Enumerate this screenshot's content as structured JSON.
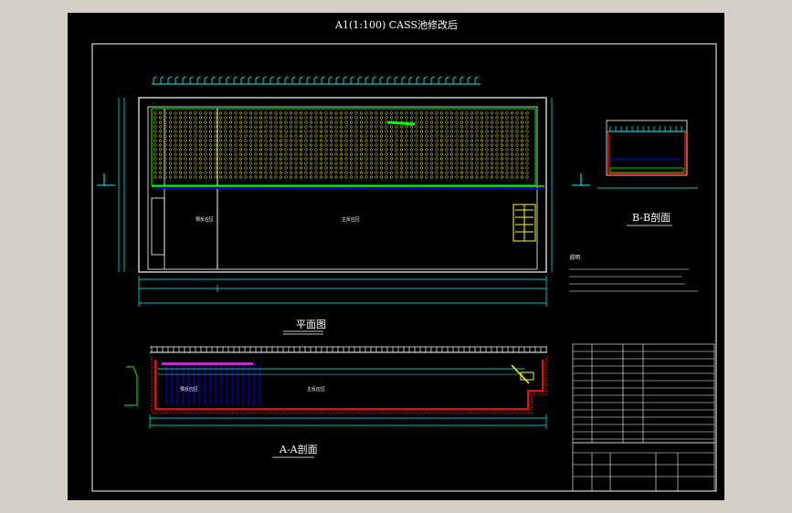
{
  "drawing": {
    "title": "A1(1:100) CASS池修改后",
    "plan_label": "平面图",
    "section_aa_label": "A-A剖面",
    "section_bb_label": "B-B剖面",
    "notes_heading": "说明"
  },
  "colors": {
    "background": "#000000",
    "frame": "#ffffff",
    "tank": "#00ff00",
    "dimension": "#00ffff",
    "aeration": "#ffff00",
    "wall": "#ff0000",
    "pipe": "#0000ff",
    "highlight": "#ff00ff"
  },
  "icons": {
    "section_marker": "section-arrow-icon",
    "north_mark": "cut-line-icon"
  }
}
